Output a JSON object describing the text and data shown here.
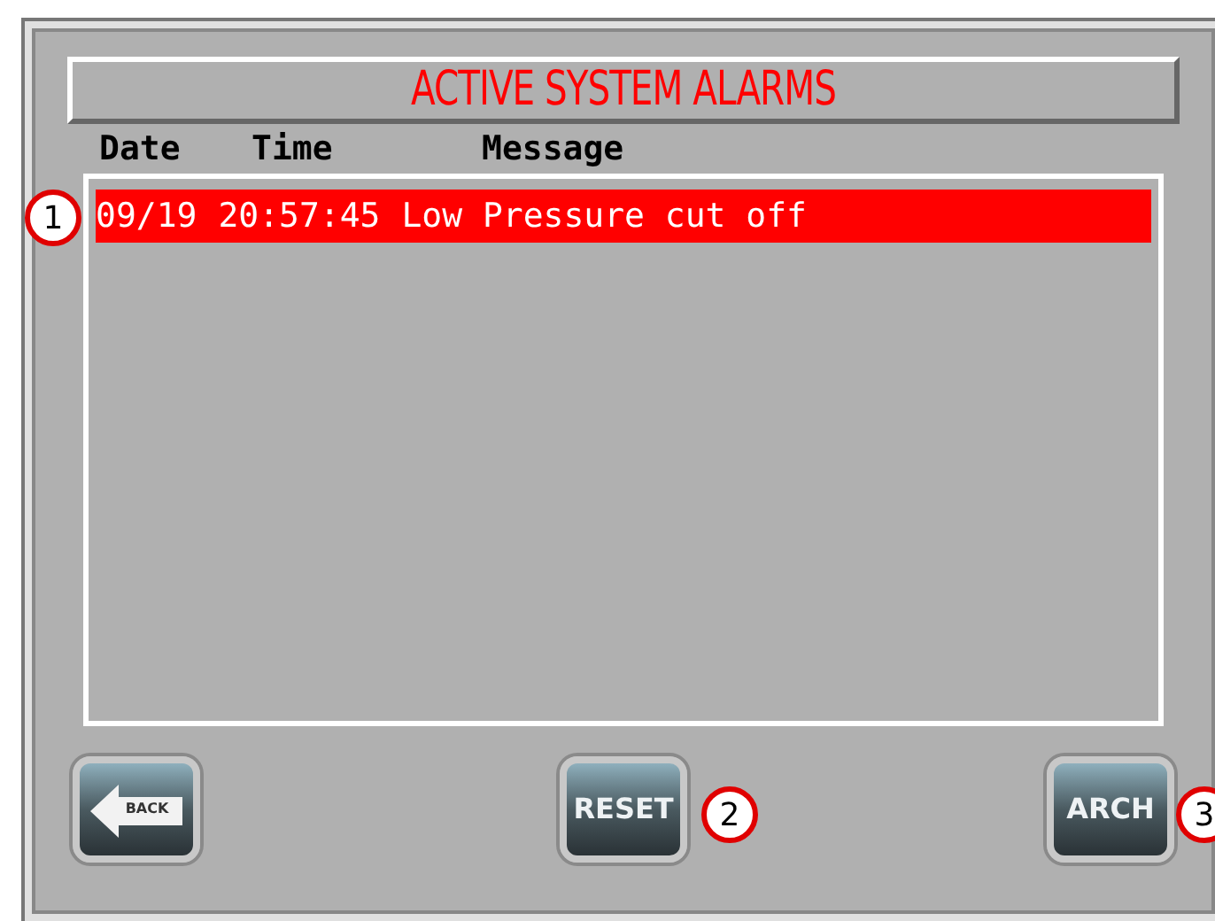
{
  "title": "ACTIVE SYSTEM ALARMS",
  "columns": [
    "Date",
    "Time",
    "Message"
  ],
  "alarms": [
    {
      "date": "09/19",
      "time": "20:57:45",
      "message": "Low Pressure cut off",
      "selected": true
    }
  ],
  "buttons": [
    {
      "kind": "back",
      "label": "BACK"
    },
    {
      "kind": "text",
      "label": "RESET"
    },
    {
      "kind": "text",
      "label": "ARCH"
    }
  ],
  "callouts": [
    "1",
    "2",
    "3"
  ]
}
